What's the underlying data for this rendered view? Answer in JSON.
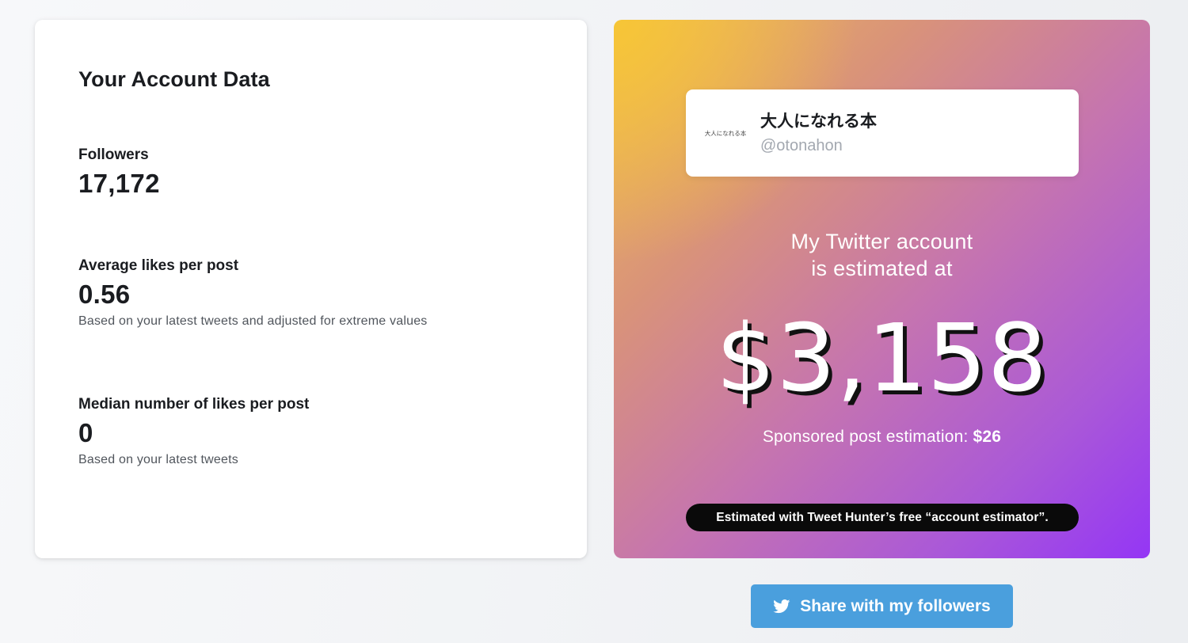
{
  "account_data": {
    "title": "Your Account Data",
    "followers": {
      "label": "Followers",
      "value": "17,172"
    },
    "average_likes": {
      "label": "Average likes per post",
      "value": "0.56",
      "note": "Based on your latest tweets and adjusted for extreme values"
    },
    "median_likes": {
      "label": "Median number of likes per post",
      "value": "0",
      "note": "Based on your latest tweets"
    }
  },
  "estimate_card": {
    "profile": {
      "avatar_text": "大人になれる本",
      "name": "大人になれる本",
      "handle": "@otonahon"
    },
    "heading_line1": "My Twitter account",
    "heading_line2": "is estimated at",
    "value": "$3,158",
    "sponsored_label": "Sponsored post estimation: ",
    "sponsored_value": "$26",
    "footer_pill": "Estimated with Tweet Hunter’s free “account estimator”."
  },
  "share_button": {
    "label": "Share with my followers",
    "icon": "twitter-bird-icon"
  },
  "colors": {
    "share_button": "#4a9fdd",
    "gradient_start": "#f7c634",
    "gradient_end": "#9436f5"
  }
}
